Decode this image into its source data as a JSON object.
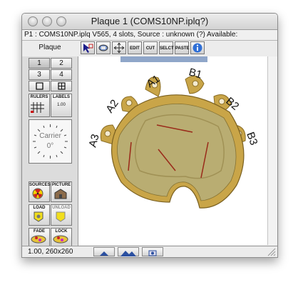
{
  "window": {
    "title": "Plaque 1 (COMS10NP.iplq?)"
  },
  "info_text": "P1 : COMS10NP.iplq V565, 4 slots, Source : unknown (?) Available:",
  "plaque_label": "Plaque",
  "toolbar": {
    "edit": "EDIT",
    "cut": "CUT",
    "select": "SELCT",
    "paste": "PASTE"
  },
  "panel": {
    "slot_buttons": [
      "1",
      "2",
      "3",
      "4"
    ],
    "rulers": "RULERS",
    "labels": "LABELS",
    "labels_value": "1.00",
    "carrier_label": "Carrier",
    "carrier_angle": "0°",
    "sources": "SOURCES",
    "picture": "PICTURE",
    "load": "LOAD",
    "unload": "UNLOAD",
    "fade": "FADE",
    "lock": "LOCK"
  },
  "plaque": {
    "labels": [
      "A1",
      "B1",
      "A2",
      "B2",
      "A3",
      "B3"
    ]
  },
  "status": {
    "zoom_text": "1.00, 260x260"
  },
  "colors": {
    "gold": "#c9a548",
    "plaque_face": "#b9ad72",
    "seed_line": "#9a2a1a"
  }
}
